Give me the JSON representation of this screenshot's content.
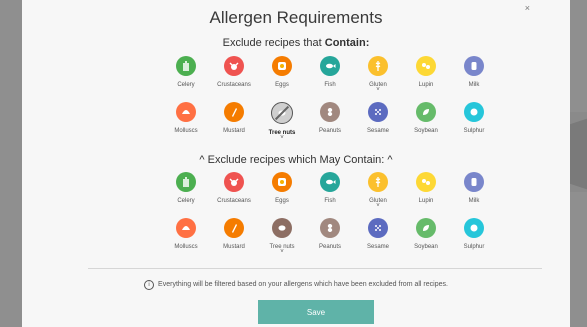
{
  "modal": {
    "title": "Allergen Requirements",
    "close_label": "×",
    "contain_prefix": "Exclude recipes that ",
    "contain_bold": "Contain:",
    "may_prefix": "^ Exclude recipes which ",
    "may_bold": "May Contain:",
    "may_suffix": " ^",
    "info_icon": "i",
    "info_text": "Everything will be filtered based on your allergens which have been excluded from all recipes.",
    "save_label": "Save"
  },
  "contain": [
    {
      "label": "Celery",
      "color": "#4caf50",
      "icon": "celery-icon"
    },
    {
      "label": "Crustaceans",
      "color": "#ef5350",
      "icon": "crustaceans-icon"
    },
    {
      "label": "Eggs",
      "color": "#f57c00",
      "icon": "eggs-icon"
    },
    {
      "label": "Fish",
      "color": "#26a69a",
      "icon": "fish-icon"
    },
    {
      "label": "Gluten",
      "color": "#fbc02d",
      "icon": "gluten-icon",
      "chevron": "˅"
    },
    {
      "label": "Lupin",
      "color": "#fdd835",
      "icon": "lupin-icon"
    },
    {
      "label": "Milk",
      "color": "#7986cb",
      "icon": "milk-icon"
    },
    {
      "label": "Molluscs",
      "color": "#ff7043",
      "icon": "molluscs-icon"
    },
    {
      "label": "Mustard",
      "color": "#f57c00",
      "icon": "mustard-icon"
    },
    {
      "label": "Tree nuts",
      "color": "#cfcfcf",
      "icon": "tree-nuts-icon",
      "selected": true,
      "chevron": "˅"
    },
    {
      "label": "Peanuts",
      "color": "#a1887f",
      "icon": "peanuts-icon"
    },
    {
      "label": "Sesame",
      "color": "#5c6bc0",
      "icon": "sesame-icon"
    },
    {
      "label": "Soybean",
      "color": "#66bb6a",
      "icon": "soybean-icon"
    },
    {
      "label": "Sulphur",
      "color": "#26c6da",
      "icon": "sulphur-icon"
    }
  ],
  "may_contain": [
    {
      "label": "Celery",
      "color": "#4caf50",
      "icon": "celery-icon"
    },
    {
      "label": "Crustaceans",
      "color": "#ef5350",
      "icon": "crustaceans-icon"
    },
    {
      "label": "Eggs",
      "color": "#f57c00",
      "icon": "eggs-icon"
    },
    {
      "label": "Fish",
      "color": "#26a69a",
      "icon": "fish-icon"
    },
    {
      "label": "Gluten",
      "color": "#fbc02d",
      "icon": "gluten-icon",
      "chevron": "˅"
    },
    {
      "label": "Lupin",
      "color": "#fdd835",
      "icon": "lupin-icon"
    },
    {
      "label": "Milk",
      "color": "#7986cb",
      "icon": "milk-icon"
    },
    {
      "label": "Molluscs",
      "color": "#ff7043",
      "icon": "molluscs-icon"
    },
    {
      "label": "Mustard",
      "color": "#f57c00",
      "icon": "mustard-icon"
    },
    {
      "label": "Tree nuts",
      "color": "#8d6e63",
      "icon": "tree-nuts-icon",
      "chevron": "˅"
    },
    {
      "label": "Peanuts",
      "color": "#a1887f",
      "icon": "peanuts-icon"
    },
    {
      "label": "Sesame",
      "color": "#5c6bc0",
      "icon": "sesame-icon"
    },
    {
      "label": "Soybean",
      "color": "#66bb6a",
      "icon": "soybean-icon"
    },
    {
      "label": "Sulphur",
      "color": "#26c6da",
      "icon": "sulphur-icon"
    }
  ]
}
